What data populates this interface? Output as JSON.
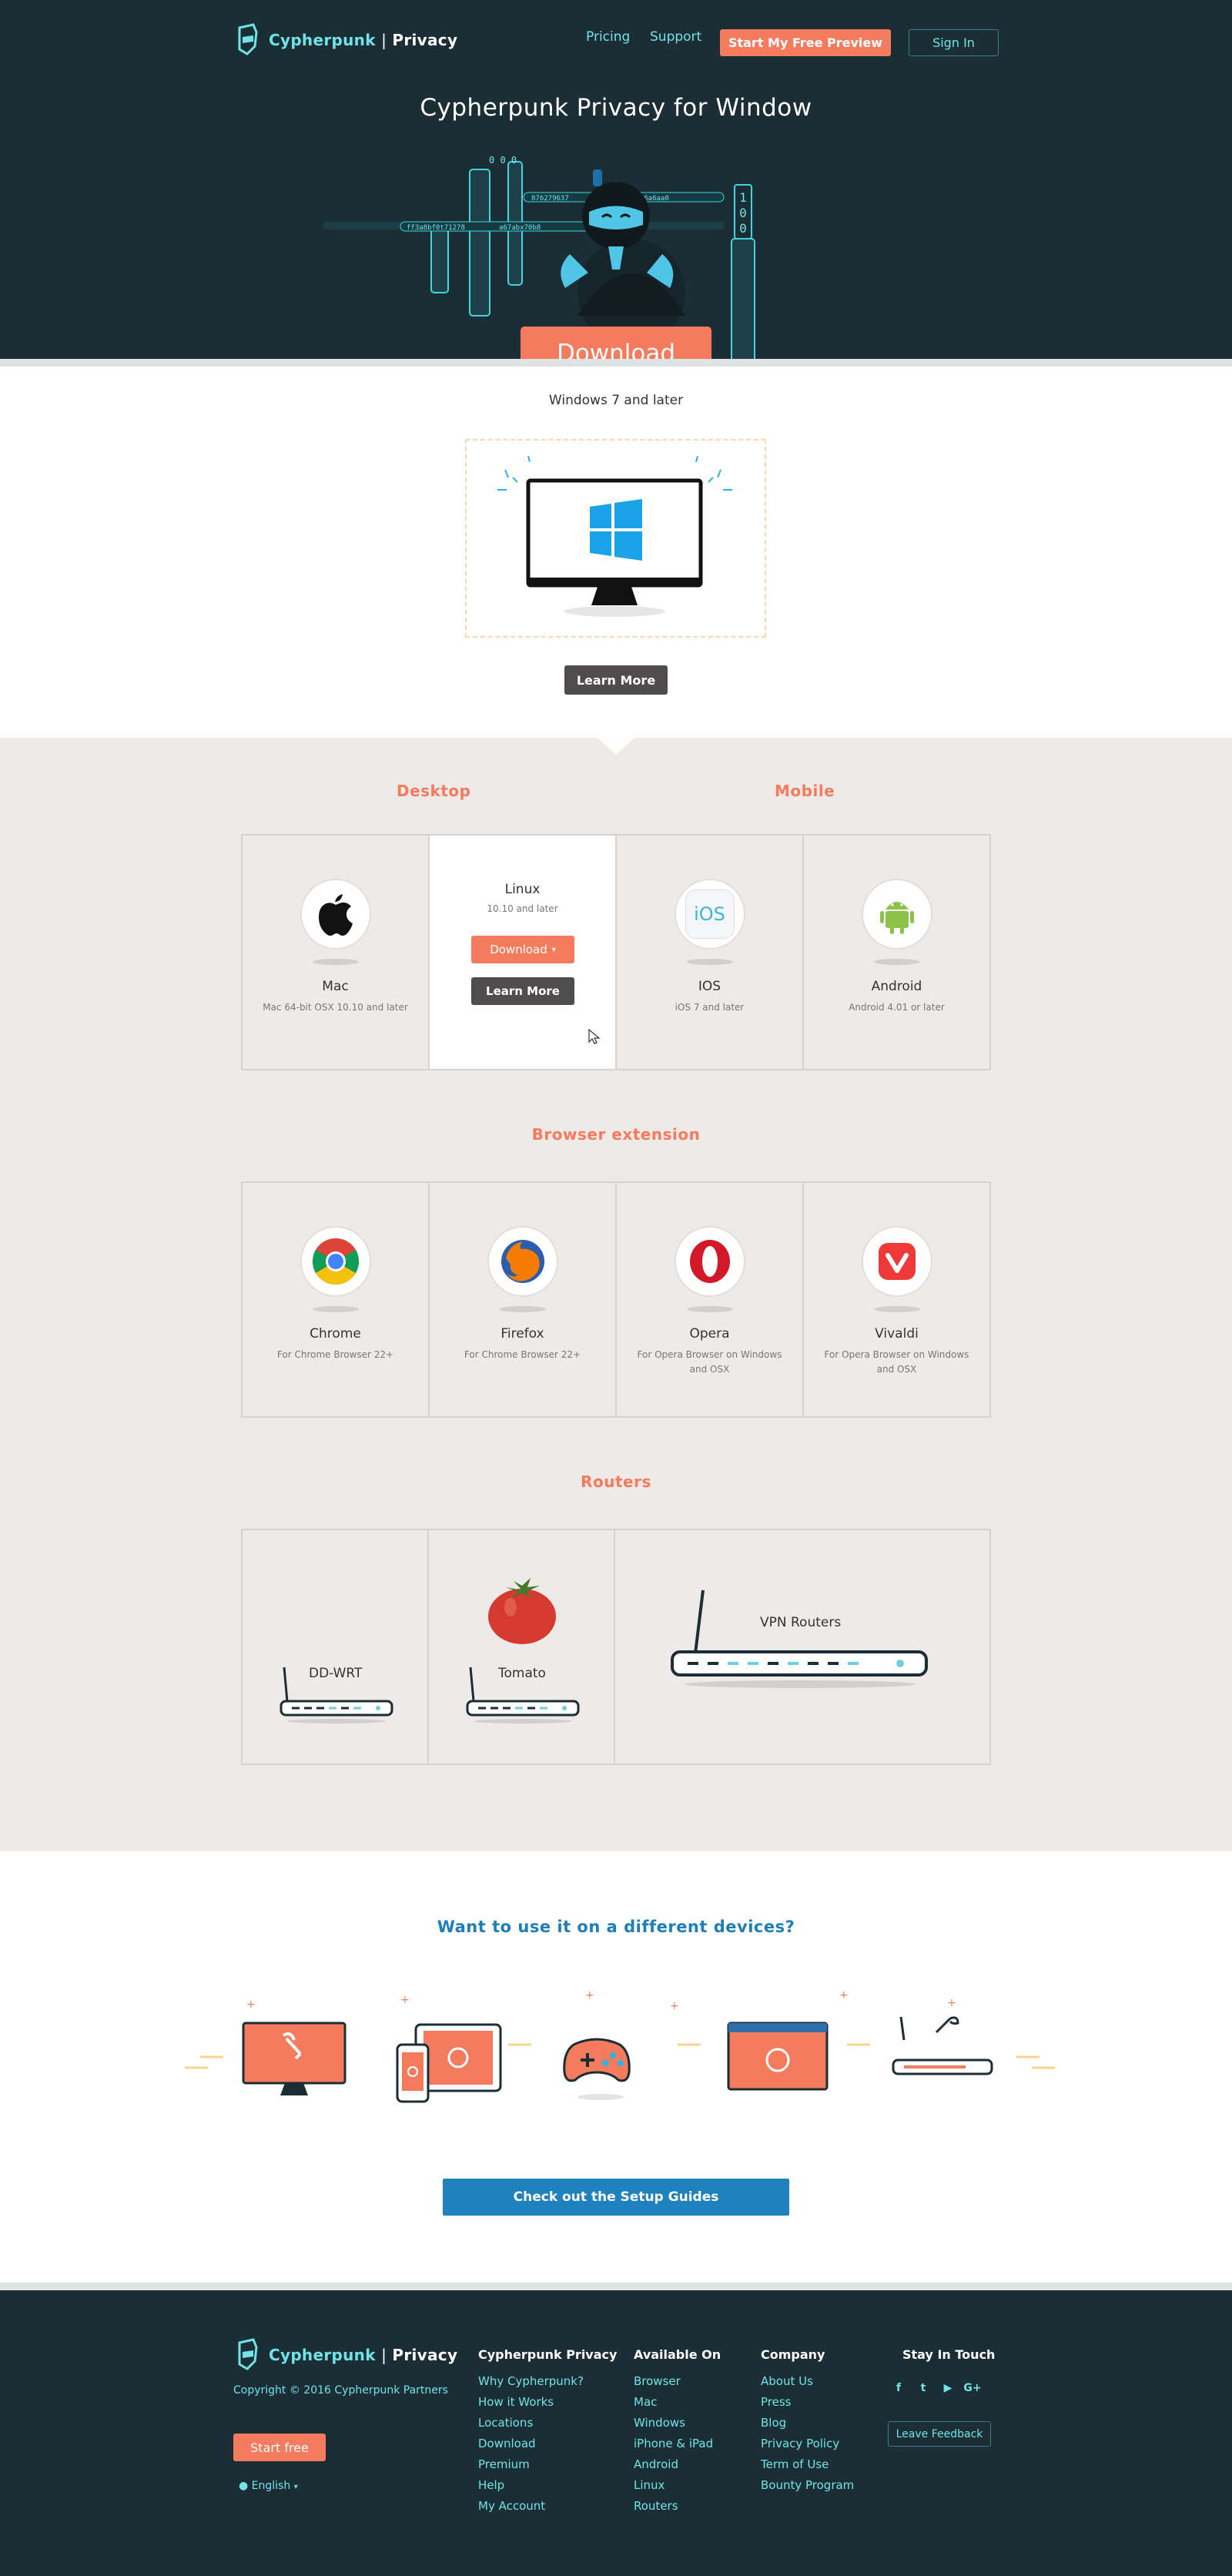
{
  "header": {
    "logo_brand": "Cypherpunk",
    "logo_separator": "|",
    "logo_product": "Privacy",
    "nav": {
      "pricing": "Pricing",
      "support": "Support"
    },
    "preview_button": "Start My Free Preview",
    "signin_button": "Sign In"
  },
  "hero": {
    "title": "Cypherpunk Privacy for Window",
    "download_button": "Download",
    "code_text_1": "876279637",
    "code_text_2": "a6a6a6aa0",
    "code_text_3": "ff3a8bf0t71278",
    "code_text_4": "a67abx70b8",
    "code_text_5": "0 0 0",
    "binary_digits": [
      "1",
      "0",
      "0"
    ]
  },
  "windows": {
    "note": "Windows 7 and later",
    "learn_more": "Learn More"
  },
  "desktop_mobile": {
    "desktop_heading": "Desktop",
    "mobile_heading": "Mobile",
    "items": [
      {
        "name": "Mac",
        "sub": "Mac 64-bit OSX 10.10 and later"
      },
      {
        "name": "Linux",
        "sub": "10.10 and later",
        "download": "Download",
        "learn_more": "Learn More"
      },
      {
        "name": "IOS",
        "sub": "iOS 7 and later",
        "icon_text": "iOS"
      },
      {
        "name": "Android",
        "sub": "Android 4.01 or later"
      }
    ]
  },
  "browsers": {
    "heading": "Browser extension",
    "items": [
      {
        "name": "Chrome",
        "sub": "For Chrome Browser 22+"
      },
      {
        "name": "Firefox",
        "sub": "For Chrome Browser 22+"
      },
      {
        "name": "Opera",
        "sub": "For Opera Browser on Windows and OSX"
      },
      {
        "name": "Vivaldi",
        "sub": "For Opera Browser on Windows and OSX"
      }
    ]
  },
  "routers": {
    "heading": "Routers",
    "items": [
      {
        "name": "DD-WRT"
      },
      {
        "name": "Tomato"
      },
      {
        "name": "VPN Routers"
      }
    ]
  },
  "devices": {
    "title": "Want to use it on a different devices?",
    "setup_button": "Check out the Setup Guides"
  },
  "footer": {
    "brand": "Cypherpunk",
    "separator": "|",
    "product": "Privacy",
    "copyright": "Copyright © 2016 Cypherpunk Partners",
    "start_free": "Start free",
    "language": "English",
    "columns": [
      {
        "title": "Cypherpunk Privacy",
        "links": [
          "Why Cypherpunk?",
          "How it Works",
          "Locations",
          "Download",
          "Premium",
          "Help",
          "My Account"
        ]
      },
      {
        "title": "Available On",
        "links": [
          "Browser",
          "Mac",
          "Windows",
          "iPhone & iPad",
          "Android",
          "Linux",
          "Routers"
        ]
      },
      {
        "title": "Company",
        "links": [
          "About Us",
          "Press",
          "Blog",
          "Privacy Policy",
          "Term of Use",
          "Bounty Program"
        ]
      }
    ],
    "stay_title": "Stay In Touch",
    "social": [
      "facebook-icon",
      "twitter-icon",
      "youtube-icon",
      "google-plus-icon"
    ],
    "social_glyphs": [
      "f",
      "t",
      "▶",
      "G+"
    ],
    "feedback_button": "Leave Feedback"
  },
  "colors": {
    "accent": "#f47b5e",
    "dark": "#1b2e35",
    "teal": "#6fe3e8",
    "blue": "#1f82bf"
  }
}
